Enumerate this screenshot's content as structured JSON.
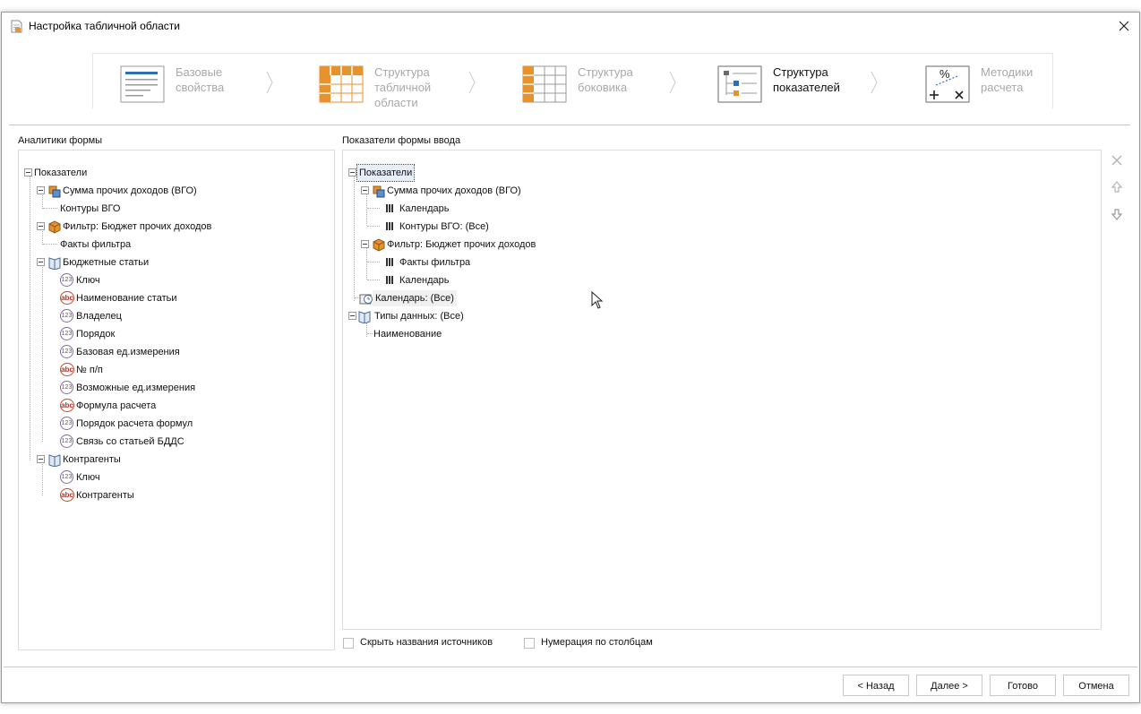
{
  "window": {
    "title": "Настройка табличной области"
  },
  "steps": [
    {
      "label": "Базовые\nсвойства",
      "icon": "base-properties-icon",
      "active": false
    },
    {
      "label": "Структура\nтабличной\nобласти",
      "icon": "table-structure-icon",
      "active": false
    },
    {
      "label": "Структура\nбоковика",
      "icon": "sidebar-structure-icon",
      "active": false
    },
    {
      "label": "Структура\nпоказателей",
      "icon": "indicators-structure-icon",
      "active": true
    },
    {
      "label": "Методики\nрасчета",
      "icon": "calc-methods-icon",
      "active": false
    }
  ],
  "left_panel": {
    "title": "Аналитики формы",
    "root": "Показатели",
    "items": [
      "Сумма прочих доходов (ВГО)",
      "Контуры ВГО",
      "Фильтр: Бюджет прочих доходов",
      "Факты фильтра",
      "Бюджетные статьи",
      "Ключ",
      "Наименование статьи",
      "Владелец",
      "Порядок",
      "Базовая ед.измерения",
      "№ п/п",
      "Возможные ед.измерения",
      "Формула расчета",
      "Порядок расчета формул",
      "Связь со статьей БДДС",
      "Контрагенты",
      "Ключ",
      "Контрагенты"
    ]
  },
  "right_panel": {
    "title": "Показатели формы ввода",
    "root": "Показатели",
    "items": [
      "Сумма прочих доходов (ВГО)",
      "Календарь",
      "Контуры ВГО: (Все)",
      "Фильтр: Бюджет прочих доходов",
      "Факты фильтра",
      "Календарь",
      "Календарь: (Все)",
      "Типы данных: (Все)",
      "Наименование"
    ]
  },
  "checkboxes": {
    "hide_sources": "Скрыть названия источников",
    "column_numbering": "Нумерация по столбцам"
  },
  "buttons": {
    "back": "< Назад",
    "next": "Далее >",
    "done": "Готово",
    "cancel": "Отмена"
  },
  "colors": {
    "accent_blue": "#2f6db5",
    "accent_orange": "#e8922e",
    "border": "#dcdcdc"
  }
}
